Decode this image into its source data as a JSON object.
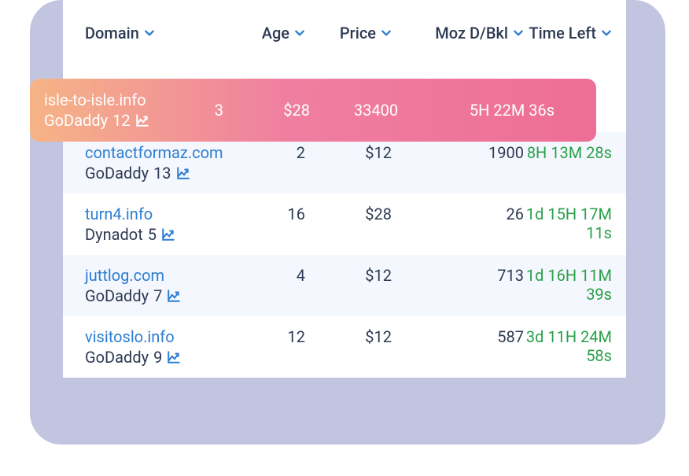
{
  "colors": {
    "backdrop": "#c2c5e0",
    "accent_start": "#f6b486",
    "accent_end": "#ee6e96",
    "link": "#2d7dd2",
    "text": "#2d3a52",
    "time": "#2aa04a"
  },
  "headers": {
    "domain": "Domain",
    "age": "Age",
    "price": "Price",
    "moz": "Moz D/Bkl",
    "time": "Time Left"
  },
  "highlight": {
    "domain": "isle-to-isle.info",
    "registrar": "GoDaddy",
    "score": "12",
    "age": "3",
    "price": "$28",
    "moz": "33400",
    "time": "5H 22M 36s"
  },
  "rows": [
    {
      "domain": "contactformaz.com",
      "registrar": "GoDaddy",
      "score": "13",
      "age": "2",
      "price": "$12",
      "moz": "1900",
      "time": "8H 13M 28s",
      "alt": true
    },
    {
      "domain": "turn4.info",
      "registrar": "Dynadot",
      "score": "5",
      "age": "16",
      "price": "$28",
      "moz": "26",
      "time": "1d 15H 17M 11s",
      "alt": false
    },
    {
      "domain": "juttlog.com",
      "registrar": "GoDaddy",
      "score": "7",
      "age": "4",
      "price": "$12",
      "moz": "713",
      "time": "1d 16H 11M 39s",
      "alt": true
    },
    {
      "domain": "visitoslo.info",
      "registrar": "GoDaddy",
      "score": "9",
      "age": "12",
      "price": "$12",
      "moz": "587",
      "time": "3d 11H 24M 58s",
      "alt": false
    }
  ]
}
